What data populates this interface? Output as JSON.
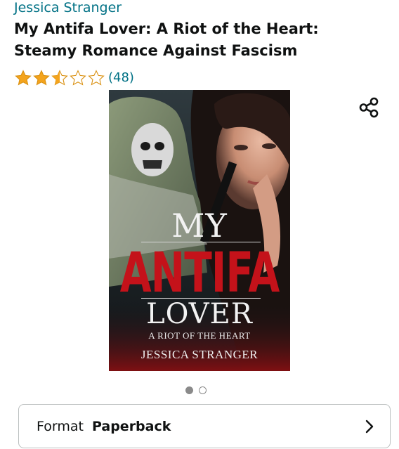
{
  "product": {
    "author": "Jessica Stranger",
    "title": "My Antifa Lover: A Riot of the Heart: Steamy Romance Against Fascism",
    "rating_stars": 2.5,
    "rating_count": "(48)"
  },
  "cover": {
    "line1": "MY",
    "line2": "ANTIFA",
    "line3": "LOVER",
    "subtitle": "A RIOT OF THE HEART",
    "author": "JESSICA STRANGER"
  },
  "carousel": {
    "count": 2,
    "active_index": 0
  },
  "format": {
    "label": "Format",
    "value": "Paperback"
  },
  "colors": {
    "link": "#007185",
    "star": "#f4a41d",
    "antifa_red": "#c4121a"
  },
  "icons": {
    "share": "share-icon",
    "chevron": "chevron-right-icon"
  }
}
